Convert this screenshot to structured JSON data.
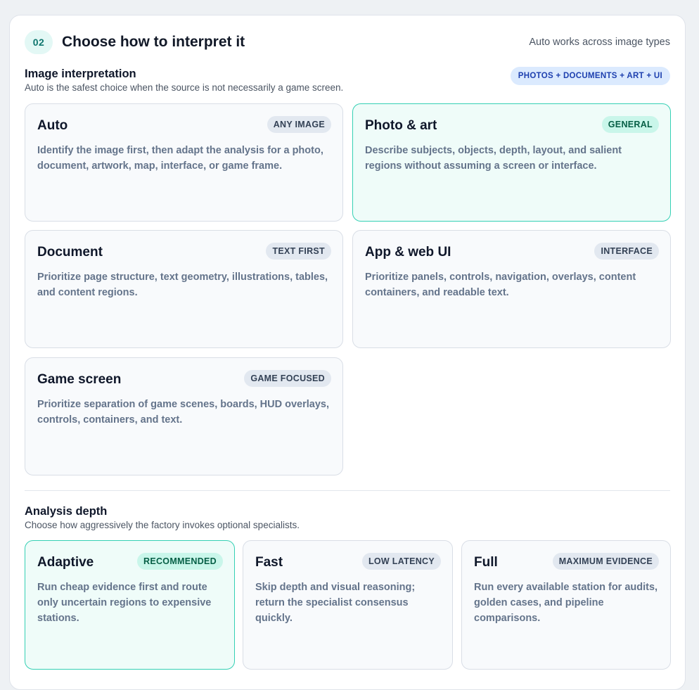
{
  "header": {
    "step": "02",
    "title": "Choose how to interpret it",
    "note": "Auto works across image types"
  },
  "interpretation": {
    "title": "Image interpretation",
    "subtitle": "Auto is the safest choice when the source is not necessarily a game screen.",
    "badge": "PHOTOS + DOCUMENTS + ART + UI",
    "options": [
      {
        "title": "Auto",
        "tag": "ANY IMAGE",
        "desc": "Identify the image first, then adapt the analysis for a photo, document, artwork, map, interface, or game frame.",
        "selected": false
      },
      {
        "title": "Photo & art",
        "tag": "GENERAL",
        "desc": "Describe subjects, objects, depth, layout, and salient regions without assuming a screen or interface.",
        "selected": true
      },
      {
        "title": "Document",
        "tag": "TEXT FIRST",
        "desc": "Prioritize page structure, text geometry, illustrations, tables, and content regions.",
        "selected": false
      },
      {
        "title": "App & web UI",
        "tag": "INTERFACE",
        "desc": "Prioritize panels, controls, navigation, overlays, content containers, and readable text.",
        "selected": false
      },
      {
        "title": "Game screen",
        "tag": "GAME FOCUSED",
        "desc": "Prioritize separation of game scenes, boards, HUD overlays, controls, containers, and text.",
        "selected": false
      }
    ]
  },
  "depth": {
    "title": "Analysis depth",
    "subtitle": "Choose how aggressively the factory invokes optional specialists.",
    "options": [
      {
        "title": "Adaptive",
        "tag": "RECOMMENDED",
        "desc": "Run cheap evidence first and route only uncertain regions to expensive stations.",
        "selected": true
      },
      {
        "title": "Fast",
        "tag": "LOW LATENCY",
        "desc": "Skip depth and visual reasoning; return the specialist consensus quickly.",
        "selected": false
      },
      {
        "title": "Full",
        "tag": "MAXIMUM EVIDENCE",
        "desc": "Run every available station for audits, golden cases, and pipeline comparisons.",
        "selected": false
      }
    ]
  }
}
